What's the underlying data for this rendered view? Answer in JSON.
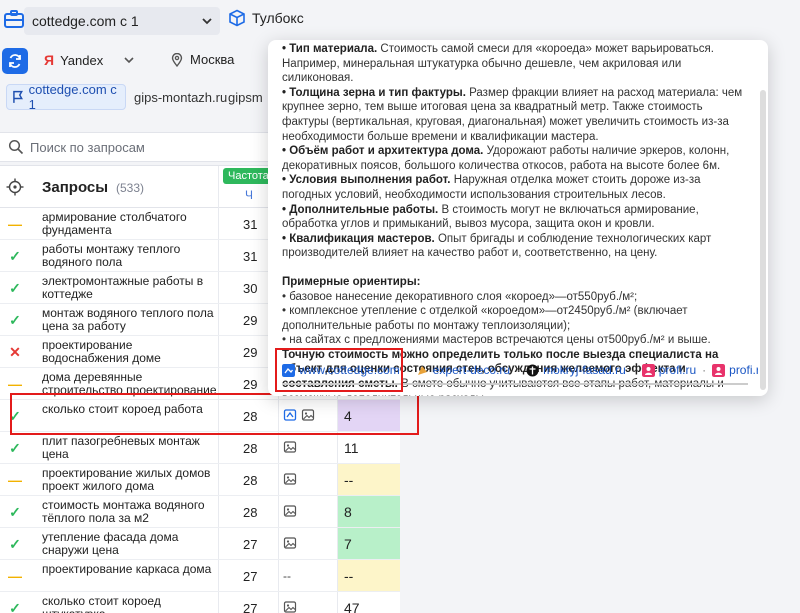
{
  "topbar": {
    "project": "cottedge.com c 1",
    "toolbox": "Тулбокс"
  },
  "row2": {
    "engine": "Yandex",
    "engine_logo": "Я",
    "region": "Москва"
  },
  "site_tabs": [
    "cottedge.com c 1",
    "gips-montazh.ru",
    "gipsm"
  ],
  "search": {
    "placeholder": "Поиск по запросам"
  },
  "table": {
    "title": "Запросы",
    "count": "(533)",
    "freq_badge": "Частота",
    "freq_sub": "Ч",
    "rows": [
      {
        "status": "mid",
        "query": "армирование столбчатого фундамента",
        "freq": "31",
        "icon": "none",
        "pos": "",
        "pos_color": "white"
      },
      {
        "status": "ok",
        "query": "работы монтажу теплого водяного пола",
        "freq": "31",
        "icon": "none",
        "pos": "",
        "pos_color": "white"
      },
      {
        "status": "ok",
        "query": "электромонтажные работы в коттедже",
        "freq": "30",
        "icon": "none",
        "pos": "",
        "pos_color": "white"
      },
      {
        "status": "ok",
        "query": "монтаж водяного теплого пола цена за работу",
        "freq": "29",
        "icon": "none",
        "pos": "",
        "pos_color": "white"
      },
      {
        "status": "bad",
        "query": "проектирование водоснабжения доме",
        "freq": "29",
        "icon": "none",
        "pos": "",
        "pos_color": "white"
      },
      {
        "status": "mid",
        "query": "дома деревянные строительство проектирование",
        "freq": "29",
        "icon": "none",
        "pos": "",
        "pos_color": "white"
      },
      {
        "status": "ok",
        "query": "сколько стоит короед работа",
        "freq": "28",
        "icon": "double",
        "pos": "4",
        "pos_color": "purple"
      },
      {
        "status": "ok",
        "query": "плит пазогребневых монтаж цена",
        "freq": "28",
        "icon": "image",
        "pos": "11",
        "pos_color": "white"
      },
      {
        "status": "mid",
        "query": "проектирование жилых домов проект жилого дома",
        "freq": "28",
        "icon": "image",
        "pos": "--",
        "pos_color": "yellow"
      },
      {
        "status": "ok",
        "query": "стоимость монтажа водяного тёплого пола за м2",
        "freq": "28",
        "icon": "image",
        "pos": "8",
        "pos_color": "green"
      },
      {
        "status": "ok",
        "query": "утепление фасада дома снаружи цена",
        "freq": "27",
        "icon": "image",
        "pos": "7",
        "pos_color": "green"
      },
      {
        "status": "mid",
        "query": "проектирование каркаса дома",
        "freq": "27",
        "icon": "dash",
        "pos": "--",
        "pos_color": "yellow"
      },
      {
        "status": "ok",
        "query": "сколько стоит короед штукатурка",
        "freq": "27",
        "icon": "image",
        "pos": "47",
        "pos_color": "white"
      }
    ]
  },
  "popup": {
    "p1_bold": "• Тип материала.",
    "p1": " Стоимость самой смеси для «короеда» может варьироваться. Например, минеральная штукатурка обычно дешевле, чем акриловая или силиконовая.",
    "p2_bold": "• Толщина зерна и тип фактуры.",
    "p2": " Размер фракции влияет на расход материала: чем крупнее зерно, тем выше итоговая цена за квадратный метр. Также стоимость фактуры (вертикальная, круговая, диагональная) может увеличить стоимость из-за необходимости больше времени и квалификации мастера.",
    "p3_bold": "• Объём работ и архитектура дома.",
    "p3": " Удорожают работы наличие эркеров, колонн, декоративных поясов, большого количества откосов, работа на высоте более 6м.",
    "p4_bold": "• Условия выполнения работ.",
    "p4": " Наружная отделка может стоить дороже из-за погодных условий, необходимости использования строительных лесов.",
    "p5_bold": "• Дополнительные работы.",
    "p5": " В стоимость могут не включаться армирование, обработка углов и примыканий, вывоз мусора, защита окон и кровли.",
    "p6_bold": "• Квалификация мастеров.",
    "p6": " Опыт бригады и соблюдение технологических карт производителей влияет на качество работ и, соответственно, на цену.",
    "h_bold": "Примерные ориентиры:",
    "l1": "• базовое нанесение декоративного слоя «короед»—от550руб./м²;",
    "l2": "• комплексное утепление с отделкой «короедом»—от2450руб./м² (включает дополнительные работы по монтажу теплоизоляции);",
    "l3": "• на сайтах с предложениями мастеров встречаются цены от500руб./м² и выше.",
    "final_bold": "Точную стоимость можно определить только после выезда специалиста на объект для оценки состояния стен, обсуждения желаемого эффекта и составления сметы.",
    "final": " В смете обычно учитываются все этапы работ, материалы и возможные дополнительные расходы.",
    "sources": [
      "www.cottedge.com",
      "expert-deco.ru",
      "mokryj-fasad.ru",
      "profi.ru",
      "profi.ru"
    ]
  },
  "colors": {
    "accent": "#1e6be6",
    "ok": "#2eb85c",
    "bad": "#e53935",
    "mid": "#f2b200",
    "highlight": "#e31b1b"
  }
}
